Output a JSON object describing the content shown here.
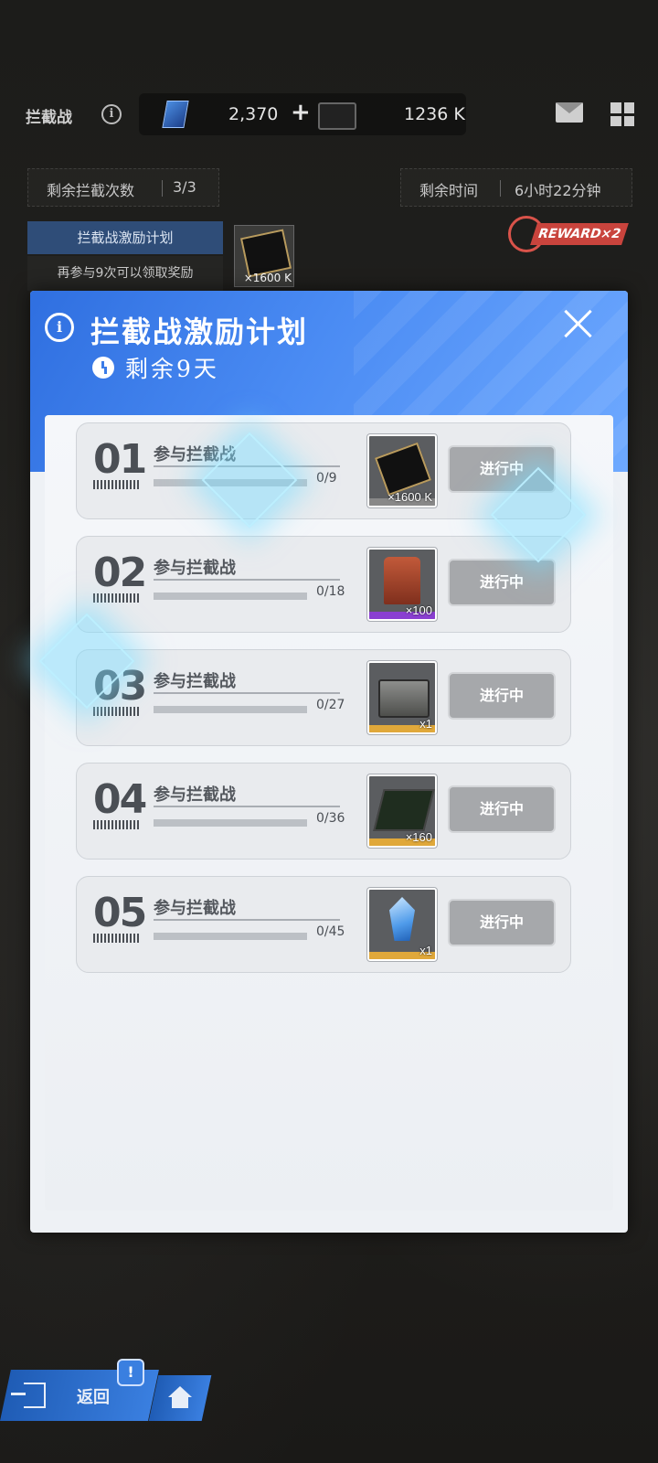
{
  "header": {
    "title": "拦截战",
    "gems": "2,370",
    "gems_add": "+",
    "card_amount": "1236 K"
  },
  "status": {
    "remaining_attempts_label": "剩余拦截次数",
    "remaining_attempts_value": "3/3",
    "remaining_time_label": "剩余时间",
    "remaining_time_value": "6小时22分钟",
    "reward_badge": "REWARD×2"
  },
  "plan": {
    "tab_label": "拦截战激励计划",
    "hint": "再参与9次可以领取奖励",
    "thumb_qty": "×1600 K"
  },
  "modal": {
    "title": "拦截战激励计划",
    "days_left": "剩余9天",
    "tasks": [
      {
        "num": "01",
        "label": "参与拦截战",
        "progress_text": "0/9",
        "progress": 0,
        "qty": "×1600 K",
        "status": "进行中",
        "item": "card-icon",
        "rarity": "#888888"
      },
      {
        "num": "02",
        "label": "参与拦截战",
        "progress_text": "0/18",
        "progress": 0,
        "qty": "×100",
        "status": "进行中",
        "item": "vest-icon",
        "rarity": "#8a3fd1"
      },
      {
        "num": "03",
        "label": "参与拦截战",
        "progress_text": "0/27",
        "progress": 0,
        "qty": "x1",
        "status": "进行中",
        "item": "crate-icon",
        "rarity": "#e0a83a"
      },
      {
        "num": "04",
        "label": "参与拦截战",
        "progress_text": "0/36",
        "progress": 0,
        "qty": "×160",
        "status": "进行中",
        "item": "chip-icon",
        "rarity": "#e0a83a"
      },
      {
        "num": "05",
        "label": "参与拦截战",
        "progress_text": "0/45",
        "progress": 0,
        "qty": "x1",
        "status": "进行中",
        "item": "crystal-icon",
        "rarity": "#e0a83a"
      }
    ]
  },
  "nav": {
    "back_label": "返回",
    "alert": "!"
  }
}
